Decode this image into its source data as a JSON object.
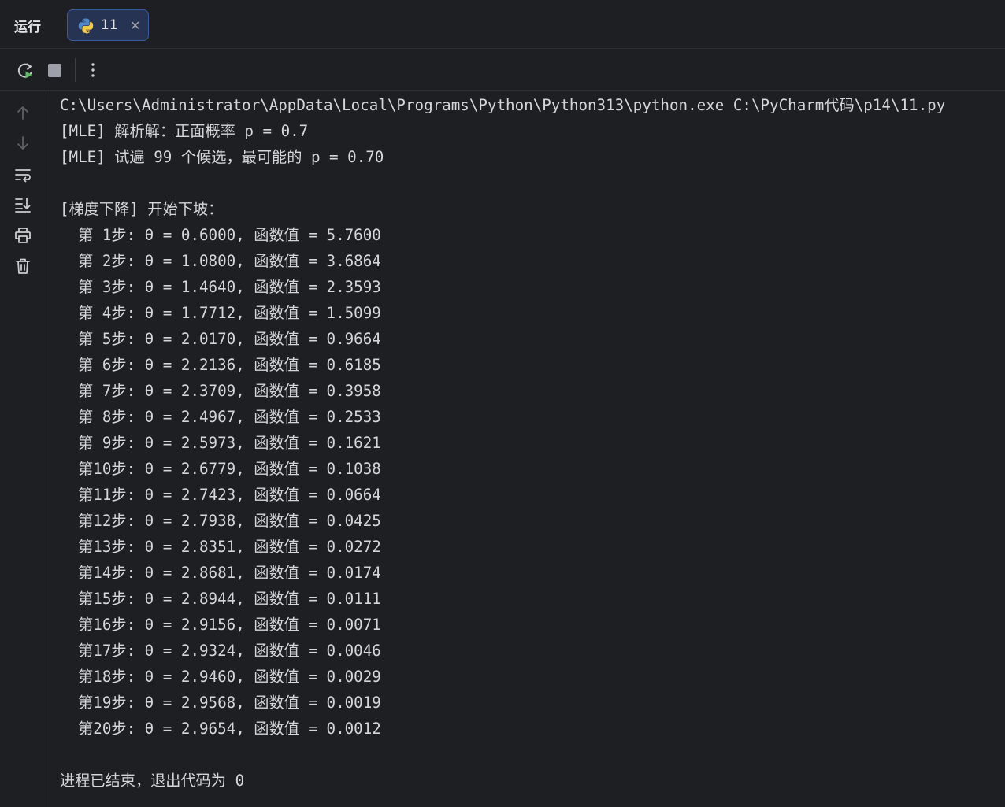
{
  "tabbar": {
    "title": "运行",
    "tab": {
      "label": "11"
    }
  },
  "console": {
    "lines": [
      "C:\\Users\\Administrator\\AppData\\Local\\Programs\\Python\\Python313\\python.exe C:\\PyCharm代码\\p14\\11.py",
      "[MLE] 解析解：正面概率 p = 0.7",
      "[MLE] 试遍 99 个候选，最可能的 p = 0.70",
      "",
      "[梯度下降] 开始下坡：",
      "  第 1步: θ = 0.6000, 函数值 = 5.7600",
      "  第 2步: θ = 1.0800, 函数值 = 3.6864",
      "  第 3步: θ = 1.4640, 函数值 = 2.3593",
      "  第 4步: θ = 1.7712, 函数值 = 1.5099",
      "  第 5步: θ = 2.0170, 函数值 = 0.9664",
      "  第 6步: θ = 2.2136, 函数值 = 0.6185",
      "  第 7步: θ = 2.3709, 函数值 = 0.3958",
      "  第 8步: θ = 2.4967, 函数值 = 0.2533",
      "  第 9步: θ = 2.5973, 函数值 = 0.1621",
      "  第10步: θ = 2.6779, 函数值 = 0.1038",
      "  第11步: θ = 2.7423, 函数值 = 0.0664",
      "  第12步: θ = 2.7938, 函数值 = 0.0425",
      "  第13步: θ = 2.8351, 函数值 = 0.0272",
      "  第14步: θ = 2.8681, 函数值 = 0.0174",
      "  第15步: θ = 2.8944, 函数值 = 0.0111",
      "  第16步: θ = 2.9156, 函数值 = 0.0071",
      "  第17步: θ = 2.9324, 函数值 = 0.0046",
      "  第18步: θ = 2.9460, 函数值 = 0.0029",
      "  第19步: θ = 2.9568, 函数值 = 0.0019",
      "  第20步: θ = 2.9654, 函数值 = 0.0012",
      "",
      "进程已结束，退出代码为 0"
    ]
  },
  "icons": {
    "tab": [
      "python-icon",
      "close-icon"
    ],
    "toolbar": [
      "rerun-icon",
      "stop-icon",
      "more-options-icon"
    ],
    "sidebar": [
      "scroll-up-icon",
      "scroll-down-icon",
      "soft-wrap-icon",
      "scroll-to-end-icon",
      "print-icon",
      "trash-icon"
    ]
  },
  "colors": {
    "background": "#1e1f22",
    "text": "#d4d6db",
    "tab_active_bg": "#263353",
    "tab_active_border": "#3d5a9e",
    "rerun_accent": "#5fb865"
  }
}
